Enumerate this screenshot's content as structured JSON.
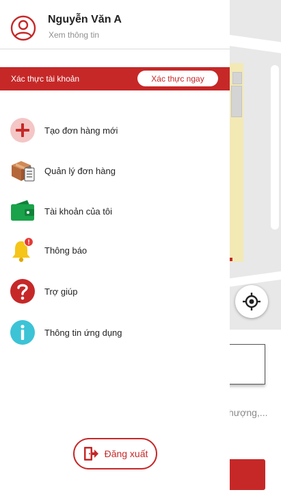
{
  "profile": {
    "name": "Nguyễn Văn A",
    "view_info": "Xem thông tin"
  },
  "verify": {
    "label": "Xác thực tài khoản",
    "button": "Xác thực ngay"
  },
  "menu": {
    "items": [
      {
        "label": "Tạo đơn hàng mới",
        "icon": "add-circle-icon"
      },
      {
        "label": "Quản lý đơn hàng",
        "icon": "package-clipboard-icon"
      },
      {
        "label": "Tài khoản của tôi",
        "icon": "wallet-icon"
      },
      {
        "label": "Thông báo",
        "icon": "bell-icon",
        "badge": "!"
      },
      {
        "label": "Trợ giúp",
        "icon": "help-icon"
      },
      {
        "label": "Thông tin ứng dụng",
        "icon": "info-icon"
      }
    ]
  },
  "logout": {
    "label": "Đăng xuất"
  },
  "background": {
    "hint_text": "hượng,..."
  },
  "colors": {
    "accent": "#c62828",
    "wallet_green": "#1aa34a",
    "info_teal": "#3cc3d6",
    "bell_yellow": "#f5c518"
  }
}
